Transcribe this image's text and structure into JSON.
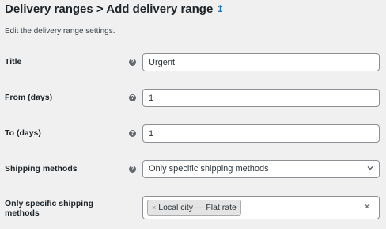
{
  "header": {
    "title": "Delivery ranges > Add delivery range",
    "up_icon": "↥"
  },
  "description": "Edit the delivery range settings.",
  "form": {
    "title": {
      "label": "Title",
      "value": "Urgent"
    },
    "from_days": {
      "label": "From (days)",
      "value": "1"
    },
    "to_days": {
      "label": "To (days)",
      "value": "1"
    },
    "shipping_methods": {
      "label": "Shipping methods",
      "selected": "Only specific shipping methods"
    },
    "specific_methods": {
      "label_line1": "Only specific shipping",
      "label_line2": "methods",
      "chips": [
        "Local city — Flat rate"
      ],
      "chip_remove": "×",
      "clear": "×"
    }
  },
  "icons": {
    "help": "help-icon",
    "help_glyph": "?",
    "chevron": "chevron-down-icon"
  },
  "colors": {
    "background": "#f0f0f1",
    "link": "#2271b1",
    "help_bg": "#646970",
    "border": "#8c8f94"
  }
}
